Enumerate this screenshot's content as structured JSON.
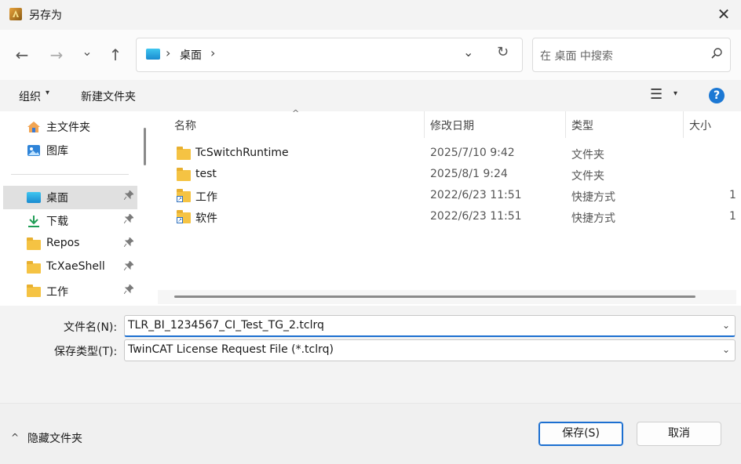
{
  "window": {
    "title": "另存为",
    "close_glyph": "✕"
  },
  "nav": {
    "back_glyph": "←",
    "forward_glyph": "→",
    "recent_glyph": "⌄",
    "up_glyph": "↑",
    "address": "桌面",
    "sep": "›",
    "refresh_glyph": "↻",
    "dropdown_glyph": "⌄",
    "search_placeholder": "在 桌面 中搜索",
    "search_glyph": "⚲"
  },
  "toolbar": {
    "organize": "组织",
    "caret": "▾",
    "new_folder": "新建文件夹",
    "view_glyph": "☰",
    "help": "?"
  },
  "sidebar": {
    "items": [
      {
        "label": "主文件夹",
        "icon": "home-icon",
        "pinned": false
      },
      {
        "label": "图库",
        "icon": "gallery-icon",
        "pinned": false
      },
      {
        "label": "桌面",
        "icon": "desktop-icon",
        "pinned": true,
        "selected": true
      },
      {
        "label": "下载",
        "icon": "download-icon",
        "pinned": true
      },
      {
        "label": "Repos",
        "icon": "folder-icon",
        "pinned": true
      },
      {
        "label": "TcXaeShell",
        "icon": "folder-icon",
        "pinned": true
      },
      {
        "label": "工作",
        "icon": "folder-icon",
        "pinned": true
      }
    ],
    "pin_glyph": "📌"
  },
  "columns": {
    "name": "名称",
    "modified": "修改日期",
    "type": "类型",
    "size": "大小",
    "sort_glyph": "^"
  },
  "files": [
    {
      "name": "TcSwitchRuntime",
      "modified": "2025/7/10 9:42",
      "type": "文件夹",
      "size": "",
      "icon": "folder-icon"
    },
    {
      "name": "test",
      "modified": "2025/8/1 9:24",
      "type": "文件夹",
      "size": "",
      "icon": "folder-icon"
    },
    {
      "name": "工作",
      "modified": "2022/6/23 11:51",
      "type": "快捷方式",
      "size": "1",
      "icon": "folder-shortcut-icon"
    },
    {
      "name": "软件",
      "modified": "2022/6/23 11:51",
      "type": "快捷方式",
      "size": "1",
      "icon": "folder-shortcut-icon"
    }
  ],
  "form": {
    "filename_label": "文件名(N):",
    "filename_value": "TLR_BI_1234567_CI_Test_TG_2.tclrq",
    "savetype_label": "保存类型(T):",
    "savetype_value": "TwinCAT License Request File (*.tclrq)",
    "dd_glyph": "⌄"
  },
  "footer": {
    "hide_folders": "隐藏文件夹",
    "caret_up": "^",
    "save": "保存(S)",
    "cancel": "取消"
  },
  "colors": {
    "accent": "#1c6fd0",
    "folder": "#f5c343",
    "selected_bg": "#e0e0e0"
  }
}
